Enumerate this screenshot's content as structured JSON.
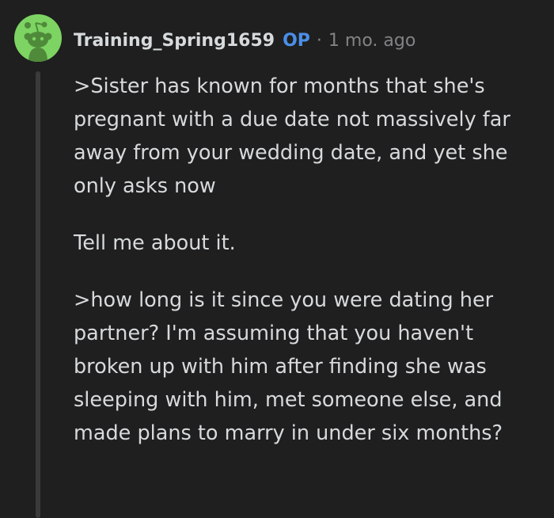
{
  "comment": {
    "author": "Training_Spring1659",
    "op_badge": "OP",
    "separator": "·",
    "timestamp": "1 mo. ago",
    "avatar_icon": "reddit-snoo-icon",
    "paragraphs": [
      ">Sister has known for months that she's pregnant with a due date not massively far away from your wedding date, and yet she only asks now",
      "Tell me about it.",
      ">how long is it since you were dating her partner? I'm assuming that you haven't broken up with him after finding she was sleeping with him, met someone else, and made plans to marry in under six months?"
    ]
  },
  "colors": {
    "background": "#1f1f1f",
    "text": "#d7dadc",
    "muted": "#818384",
    "op_blue": "#4a8fe8",
    "avatar_green": "#7dd463"
  }
}
